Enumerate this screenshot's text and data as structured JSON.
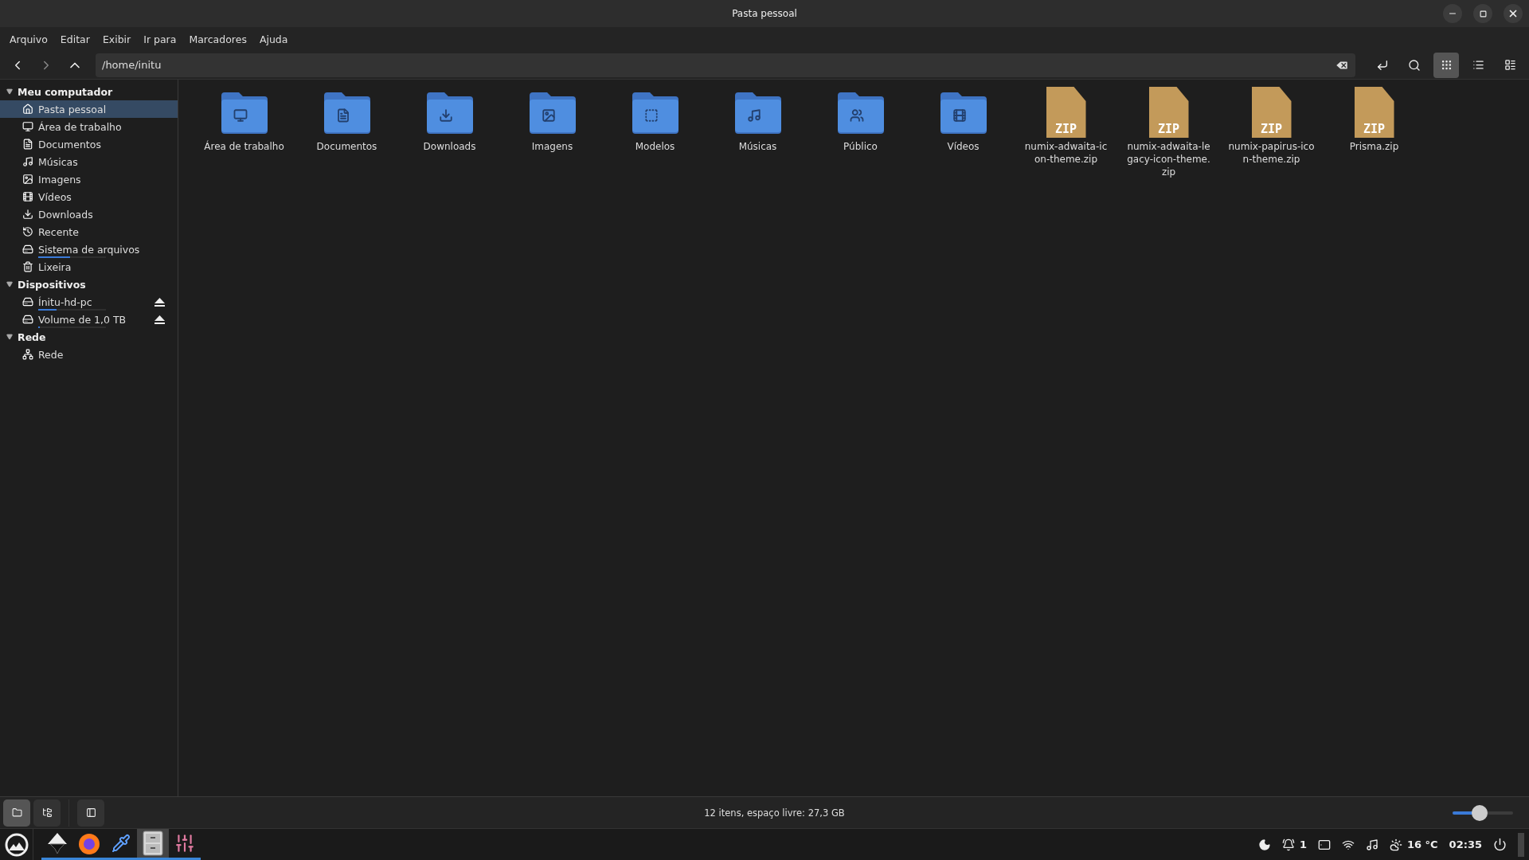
{
  "window": {
    "title": "Pasta pessoal"
  },
  "menu": [
    "Arquivo",
    "Editar",
    "Exibir",
    "Ir para",
    "Marcadores",
    "Ajuda"
  ],
  "toolbar": {
    "path": "/home/initu",
    "views": [
      {
        "kind": "grid",
        "selected": true
      },
      {
        "kind": "list",
        "selected": false
      },
      {
        "kind": "compact",
        "selected": false
      }
    ]
  },
  "sidebar": [
    {
      "title": "Meu computador",
      "expanded": true,
      "items": [
        {
          "kind": "home",
          "label": "Pasta pessoal",
          "selected": true
        },
        {
          "kind": "desktop",
          "label": "Área de trabalho",
          "selected": false
        },
        {
          "kind": "document",
          "label": "Documentos",
          "selected": false
        },
        {
          "kind": "music",
          "label": "Músicas",
          "selected": false
        },
        {
          "kind": "image",
          "label": "Imagens",
          "selected": false
        },
        {
          "kind": "video",
          "label": "Vídeos",
          "selected": false
        },
        {
          "kind": "download",
          "label": "Downloads",
          "selected": false
        },
        {
          "kind": "recent",
          "label": "Recente",
          "selected": false
        },
        {
          "kind": "drive",
          "label": "Sistema de arquivos",
          "selected": false,
          "level": 0.47
        },
        {
          "kind": "trash",
          "label": "Lixeira",
          "selected": false
        }
      ]
    },
    {
      "title": "Dispositivos",
      "expanded": true,
      "items": [
        {
          "kind": "drive",
          "label": "Ínitu-hd-pc",
          "selected": false,
          "level": 0.27,
          "ejectable": true
        },
        {
          "kind": "drive",
          "label": "Volume de 1,0 TB",
          "selected": false,
          "level": 0.02,
          "ejectable": true
        }
      ]
    },
    {
      "title": "Rede",
      "expanded": true,
      "items": [
        {
          "kind": "network",
          "label": "Rede",
          "selected": false
        }
      ]
    }
  ],
  "files": [
    {
      "kind": "desktop",
      "name": "Área de trabalho"
    },
    {
      "kind": "document",
      "name": "Documentos"
    },
    {
      "kind": "download",
      "name": "Downloads"
    },
    {
      "kind": "image",
      "name": "Imagens"
    },
    {
      "kind": "template",
      "name": "Modelos"
    },
    {
      "kind": "music",
      "name": "Músicas"
    },
    {
      "kind": "people",
      "name": "Público"
    },
    {
      "kind": "video",
      "name": "Vídeos"
    },
    {
      "kind": "zip",
      "label": "ZIP",
      "name": "numix-adwaita-icon-theme.zip"
    },
    {
      "kind": "zip",
      "label": "ZIP",
      "name": "numix-adwaita-legacy-icon-theme.zip"
    },
    {
      "kind": "zip",
      "label": "ZIP",
      "name": "numix-papirus-icon-theme.zip"
    },
    {
      "kind": "zip",
      "label": "ZIP",
      "name": "Prisma.zip"
    }
  ],
  "status_bar": {
    "panes": [
      {
        "kind": "places",
        "selected": true
      },
      {
        "kind": "tree",
        "selected": false
      },
      {
        "kind": "sidebar",
        "selected": false
      }
    ],
    "text": "12 itens, espaço livre: 27,3 GB",
    "zoom": {
      "level": 0.45
    }
  },
  "taskbar": {
    "apps": [
      {
        "kind": "inkscape",
        "running": true,
        "selected": false
      },
      {
        "kind": "firefox",
        "running": true,
        "selected": false
      },
      {
        "kind": "picker",
        "running": true,
        "selected": false
      },
      {
        "kind": "files",
        "running": true,
        "selected": true
      },
      {
        "kind": "mixer",
        "running": true,
        "selected": false
      }
    ],
    "tray": {
      "notifications": "1",
      "temperature": "16 °C",
      "time": "02:35"
    }
  }
}
